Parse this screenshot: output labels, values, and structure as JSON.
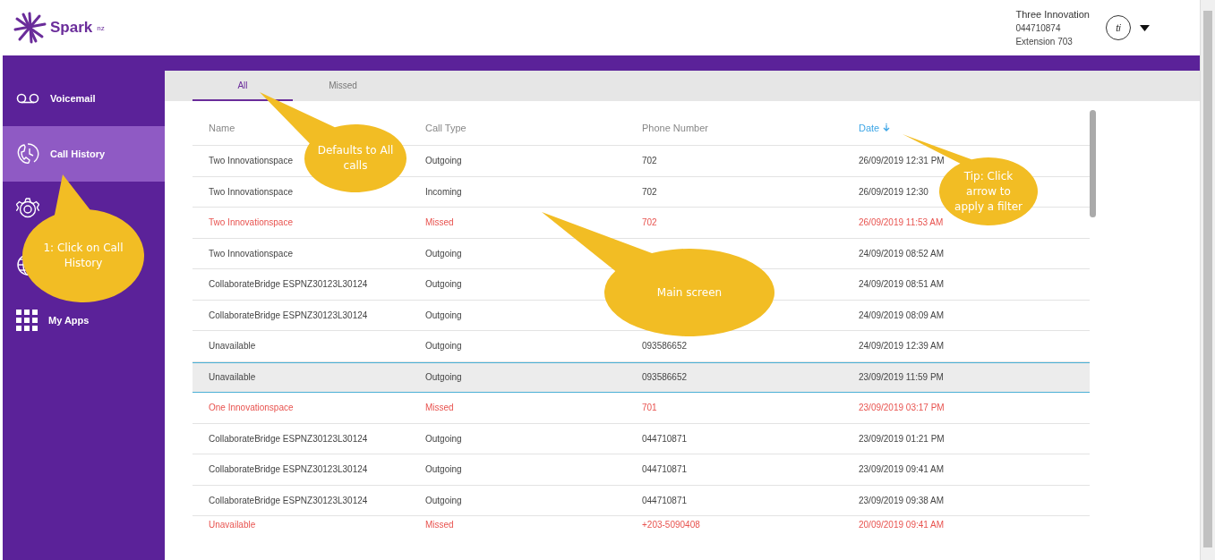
{
  "header": {
    "logo": "Spark",
    "logo_suffix": "nz",
    "user": {
      "name": "Three Innovation",
      "number": "044710874",
      "extension": "Extension 703",
      "initials": "ti"
    }
  },
  "sidebar": {
    "items": [
      {
        "label": "Voicemail",
        "selected": false
      },
      {
        "label": "Call History",
        "selected": true
      },
      {
        "selected": false
      },
      {
        "selected": false
      },
      {
        "label": "My Apps",
        "selected": false
      }
    ]
  },
  "tabs": [
    {
      "label": "All",
      "selected": true
    },
    {
      "label": "Missed",
      "selected": false
    }
  ],
  "table": {
    "columns": [
      {
        "label": "Name",
        "sorted": false
      },
      {
        "label": "Call Type",
        "sorted": false
      },
      {
        "label": "Phone Number",
        "sorted": false
      },
      {
        "label": "Date",
        "sorted": true
      }
    ],
    "rows": [
      {
        "kind": "normal",
        "selected": false,
        "name": "Two Innovationspace",
        "type": "Outgoing",
        "phone": "702",
        "date": "26/09/2019 12:31 PM"
      },
      {
        "kind": "normal",
        "selected": false,
        "name": "Two Innovationspace",
        "type": "Incoming",
        "phone": "702",
        "date": "26/09/2019 12:30"
      },
      {
        "kind": "missed",
        "selected": false,
        "name": "Two Innovationspace",
        "type": "Missed",
        "phone": "702",
        "date": "26/09/2019 11:53 AM"
      },
      {
        "kind": "normal",
        "selected": false,
        "name": "Two Innovationspace",
        "type": "Outgoing",
        "date": "24/09/2019 08:52 AM"
      },
      {
        "kind": "normal",
        "selected": false,
        "name": "CollaborateBridge ESPNZ30123L30124",
        "type": "Outgoing",
        "date": "24/09/2019 08:51 AM"
      },
      {
        "kind": "normal",
        "selected": false,
        "name": "CollaborateBridge ESPNZ30123L30124",
        "type": "Outgoing",
        "date": "24/09/2019 08:09 AM"
      },
      {
        "kind": "normal",
        "selected": false,
        "name": "Unavailable",
        "type": "Outgoing",
        "phone": "093586652",
        "date": "24/09/2019 12:39 AM"
      },
      {
        "kind": "normal",
        "selected": true,
        "name": "Unavailable",
        "type": "Outgoing",
        "phone": "093586652",
        "date": "23/09/2019 11:59 PM"
      },
      {
        "kind": "missed",
        "selected": false,
        "name": "One Innovationspace",
        "type": "Missed",
        "phone": "701",
        "date": "23/09/2019 03:17 PM"
      },
      {
        "kind": "normal",
        "selected": false,
        "name": "CollaborateBridge ESPNZ30123L30124",
        "type": "Outgoing",
        "phone": "044710871",
        "date": "23/09/2019 01:21 PM"
      },
      {
        "kind": "normal",
        "selected": false,
        "name": "CollaborateBridge ESPNZ30123L30124",
        "type": "Outgoing",
        "phone": "044710871",
        "date": "23/09/2019 09:41 AM"
      },
      {
        "kind": "normal",
        "selected": false,
        "name": "CollaborateBridge ESPNZ30123L30124",
        "type": "Outgoing",
        "phone": "044710871",
        "date": "23/09/2019 09:38 AM"
      },
      {
        "kind": "missed",
        "selected": false,
        "name": "Unavailable",
        "type": "Missed",
        "phone": "+203-5090408",
        "date": "20/09/2019 09:41 AM"
      }
    ]
  },
  "callouts": [
    "Defaults to All calls",
    "1: Click on Call History",
    "Main screen",
    "Tip: Click arrow to apply a filter"
  ]
}
